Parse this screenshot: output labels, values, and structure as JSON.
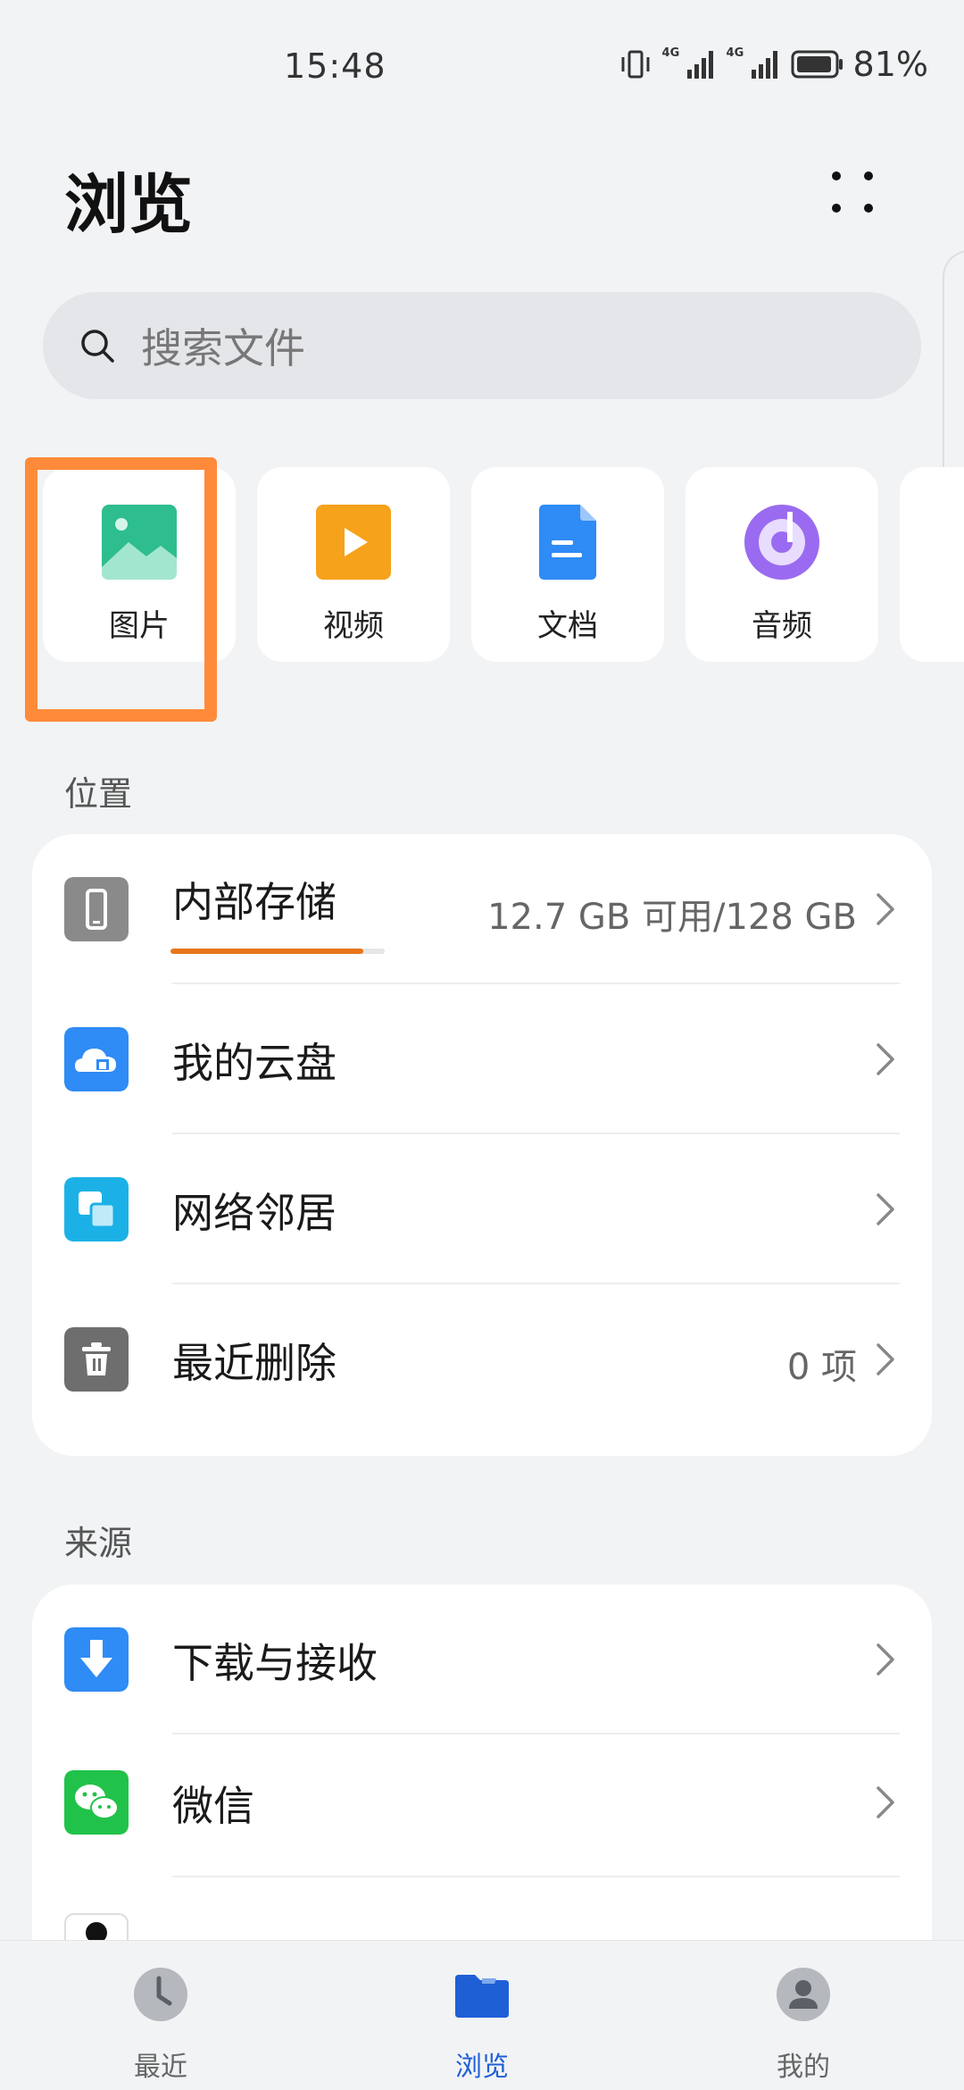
{
  "status_bar": {
    "time": "15:48",
    "battery_percent": "81%",
    "signal_1_label": "4G",
    "signal_2_label": "4G"
  },
  "header": {
    "title": "浏览"
  },
  "search": {
    "placeholder": "搜索文件"
  },
  "categories": [
    {
      "label": "图片",
      "icon": "image-icon",
      "color": "#2ebd8e"
    },
    {
      "label": "视频",
      "icon": "video-icon",
      "color": "#f7a21b"
    },
    {
      "label": "文档",
      "icon": "document-icon",
      "color": "#2f8bf5"
    },
    {
      "label": "音频",
      "icon": "audio-icon",
      "color": "#9a6bf0"
    }
  ],
  "location_section": {
    "title": "位置",
    "items": [
      {
        "label": "内部存储",
        "value": "12.7 GB 可用/128 GB",
        "icon": "phone-icon",
        "color": "#8a8a8a",
        "usage": 0.9
      },
      {
        "label": "我的云盘",
        "value": "",
        "icon": "cloud-icon",
        "color": "#2f8bf5"
      },
      {
        "label": "网络邻居",
        "value": "",
        "icon": "network-icon",
        "color": "#1cb1e6"
      },
      {
        "label": "最近删除",
        "value": "0 项",
        "icon": "trash-icon",
        "color": "#6e6e6e"
      }
    ]
  },
  "source_section": {
    "title": "来源",
    "items": [
      {
        "label": "下载与接收",
        "icon": "download-icon",
        "color": "#2f8bf5"
      },
      {
        "label": "微信",
        "icon": "wechat-icon",
        "color": "#21c24a"
      }
    ]
  },
  "bottom_nav": {
    "items": [
      {
        "label": "最近",
        "icon": "clock-icon",
        "active": false
      },
      {
        "label": "浏览",
        "icon": "folder-icon",
        "active": true
      },
      {
        "label": "我的",
        "icon": "person-icon",
        "active": false
      }
    ]
  },
  "colors": {
    "accent": "#1f5fd6",
    "highlight": "#ff8a3a",
    "storage_bar": "#e8751a"
  }
}
